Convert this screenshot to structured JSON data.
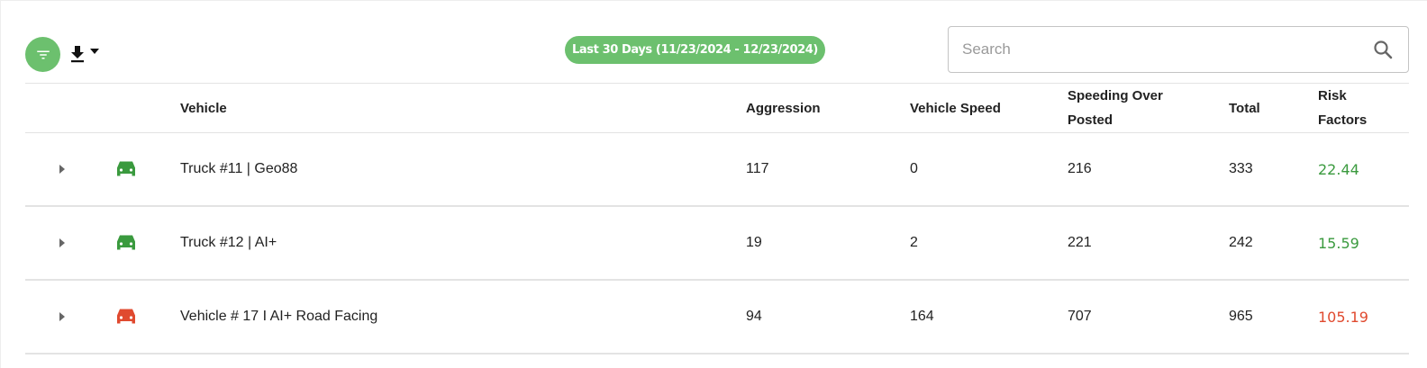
{
  "toolbar": {
    "filter_icon": "filter-list-icon",
    "download_icon": "download-icon",
    "date_range_label": "Last 30 Days (11/23/2024 - 12/23/2024)",
    "search_placeholder": "Search",
    "search_value": "",
    "accent_color": "#6cc06e"
  },
  "table": {
    "columns": {
      "vehicle": "Vehicle",
      "aggression": "Aggression",
      "vehicle_speed": "Vehicle Speed",
      "speeding_over_posted": "Speeding Over Posted",
      "total": "Total",
      "risk_factors": "Risk Factors"
    },
    "rows": [
      {
        "vehicle": "Truck #11 | Geo88",
        "aggression": "117",
        "vehicle_speed": "0",
        "speeding_over_posted": "216",
        "total": "333",
        "risk_factors": "22.44",
        "status_color": "#3a9a3e",
        "icon": "car-icon"
      },
      {
        "vehicle": "Truck #12 | AI+",
        "aggression": "19",
        "vehicle_speed": "2",
        "speeding_over_posted": "221",
        "total": "242",
        "risk_factors": "15.59",
        "status_color": "#3a9a3e",
        "icon": "car-icon"
      },
      {
        "vehicle": "Vehicle # 17 I AI+ Road Facing",
        "aggression": "94",
        "vehicle_speed": "164",
        "speeding_over_posted": "707",
        "total": "965",
        "risk_factors": "105.19",
        "status_color": "#e04a2f",
        "icon": "car-icon"
      }
    ]
  }
}
